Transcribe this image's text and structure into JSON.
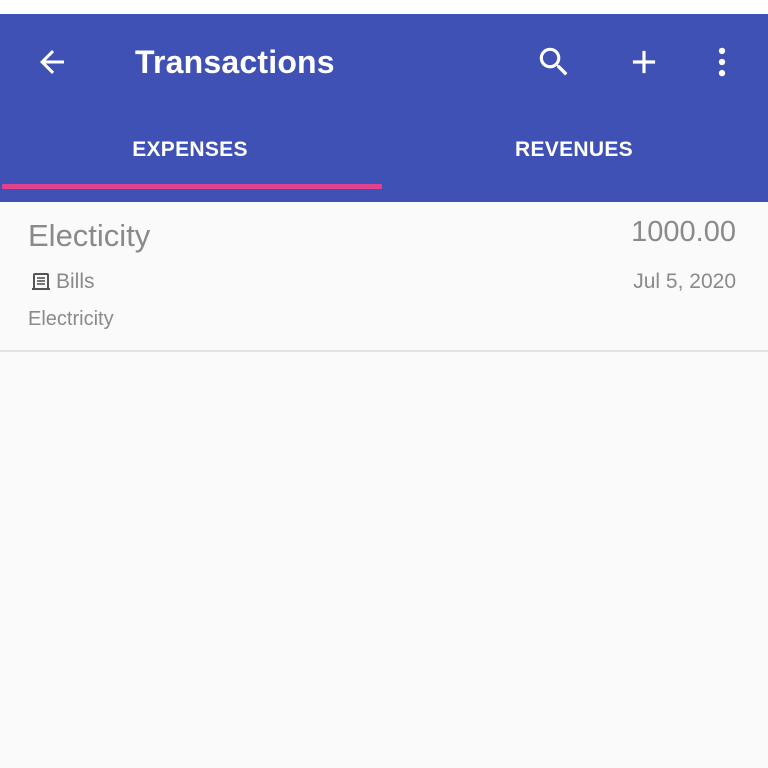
{
  "appbar": {
    "title": "Transactions",
    "icons": {
      "back": "arrow-back-icon",
      "search": "search-icon",
      "add": "plus-icon",
      "more": "more-vertical-icon"
    },
    "background_color": "#3f51b5"
  },
  "tabs": {
    "items": [
      {
        "label": "EXPENSES",
        "selected": true
      },
      {
        "label": "REVENUES",
        "selected": false
      }
    ],
    "indicator_color": "#e0428f"
  },
  "transactions": [
    {
      "name": "Electicity",
      "amount": "1000.00",
      "category": "Bills",
      "category_icon": "receipt-icon",
      "date": "Jul 5, 2020",
      "note": "Electricity"
    }
  ]
}
